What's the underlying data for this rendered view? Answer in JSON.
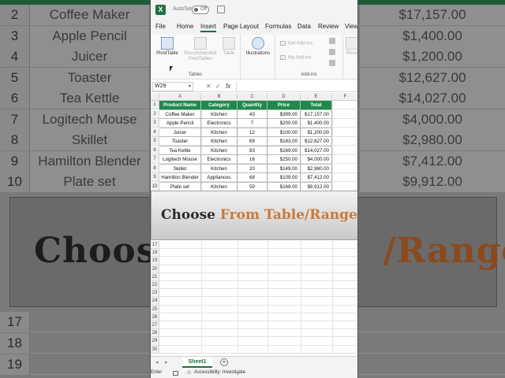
{
  "background": {
    "rows": [
      {
        "num": "2",
        "name": "Coffee Maker",
        "total": "$17,157.00"
      },
      {
        "num": "3",
        "name": "Apple Pencil",
        "total": "$1,400.00"
      },
      {
        "num": "4",
        "name": "Juicer",
        "total": "$1,200.00"
      },
      {
        "num": "5",
        "name": "Toaster",
        "total": "$12,627.00"
      },
      {
        "num": "6",
        "name": "Tea Kettle",
        "total": "$14,027.00"
      },
      {
        "num": "7",
        "name": "Logitech Mouse",
        "total": "$4,000.00"
      },
      {
        "num": "8",
        "name": "Skillet",
        "total": "$2,980.00"
      },
      {
        "num": "9",
        "name": "Hamilton Blender",
        "total": "$7,412.00"
      },
      {
        "num": "10",
        "name": "Plate set",
        "total": "$9,912.00"
      }
    ],
    "lower_rows": [
      "17",
      "18",
      "19"
    ],
    "banner": {
      "prefix": "Choose",
      "highlight": "/Range"
    }
  },
  "title_bar": {
    "app_logo": "X",
    "autosave_label": "AutoSave",
    "autosave_state": "Off",
    "save_icon": "save-icon"
  },
  "menu": {
    "tabs": [
      "File",
      "Home",
      "Insert",
      "Page Layout",
      "Formulas",
      "Data",
      "Review",
      "View"
    ],
    "active_tab": "Insert"
  },
  "ribbon": {
    "tables_group": {
      "label": "Tables",
      "pivottable": "PivotTable",
      "recommended": "Recommended PivotTables",
      "table": "Table"
    },
    "illustrations": "Illustrations",
    "addins_group": {
      "label": "Add-ins",
      "get_addins": "Get Add-ins",
      "my_addins": "My Add-ins"
    },
    "reco": "Reco"
  },
  "formula_bar": {
    "name_box": "W29",
    "cancel_icon": "✕",
    "enter_icon": "✓",
    "fx": "fx",
    "value": ""
  },
  "sheet": {
    "columns": [
      "A",
      "B",
      "C",
      "D",
      "E",
      "F"
    ],
    "header_row": [
      "Product Name",
      "Category",
      "Quantity",
      "Price",
      "Total"
    ],
    "rows": [
      [
        "Coffee Maker",
        "Kitchen",
        "43",
        "$399.00",
        "$17,157.00"
      ],
      [
        "Apple Pencil",
        "Electronics",
        "7",
        "$200.00",
        "$1,400.00"
      ],
      [
        "Juicer",
        "Kitchen",
        "12",
        "$100.00",
        "$1,200.00"
      ],
      [
        "Toaster",
        "Kitchen",
        "69",
        "$183.00",
        "$12,627.00"
      ],
      [
        "Tea Kettle",
        "Kitchen",
        "83",
        "$169.00",
        "$14,027.00"
      ],
      [
        "Logitech Mouse",
        "Electronics",
        "16",
        "$250.00",
        "$4,000.00"
      ],
      [
        "Skillet",
        "Kitchen",
        "20",
        "$149.00",
        "$2,980.00"
      ],
      [
        "Hamilton Blender",
        "Appliances",
        "68",
        "$109.00",
        "$7,412.00"
      ],
      [
        "Plate set",
        "Kitchen",
        "59",
        "$168.00",
        "$9,912.00"
      ]
    ],
    "row_numbers_top": [
      "1",
      "2",
      "3",
      "4",
      "5",
      "6",
      "7",
      "8",
      "9",
      "10"
    ],
    "row_numbers_bottom": [
      "17",
      "18",
      "19",
      "20",
      "21",
      "22",
      "23",
      "24",
      "25",
      "26",
      "27",
      "28",
      "29",
      "30"
    ],
    "header_color": "#1f8a4c"
  },
  "overlay_banner": {
    "prefix": "Choose ",
    "highlight": "From Table/Range",
    "highlight_color": "#c8793d"
  },
  "tabs": {
    "sheet_name": "Sheet1",
    "add": "+"
  },
  "status_bar": {
    "mode": "Enter",
    "accessibility": "Accessibility: Investigate"
  }
}
